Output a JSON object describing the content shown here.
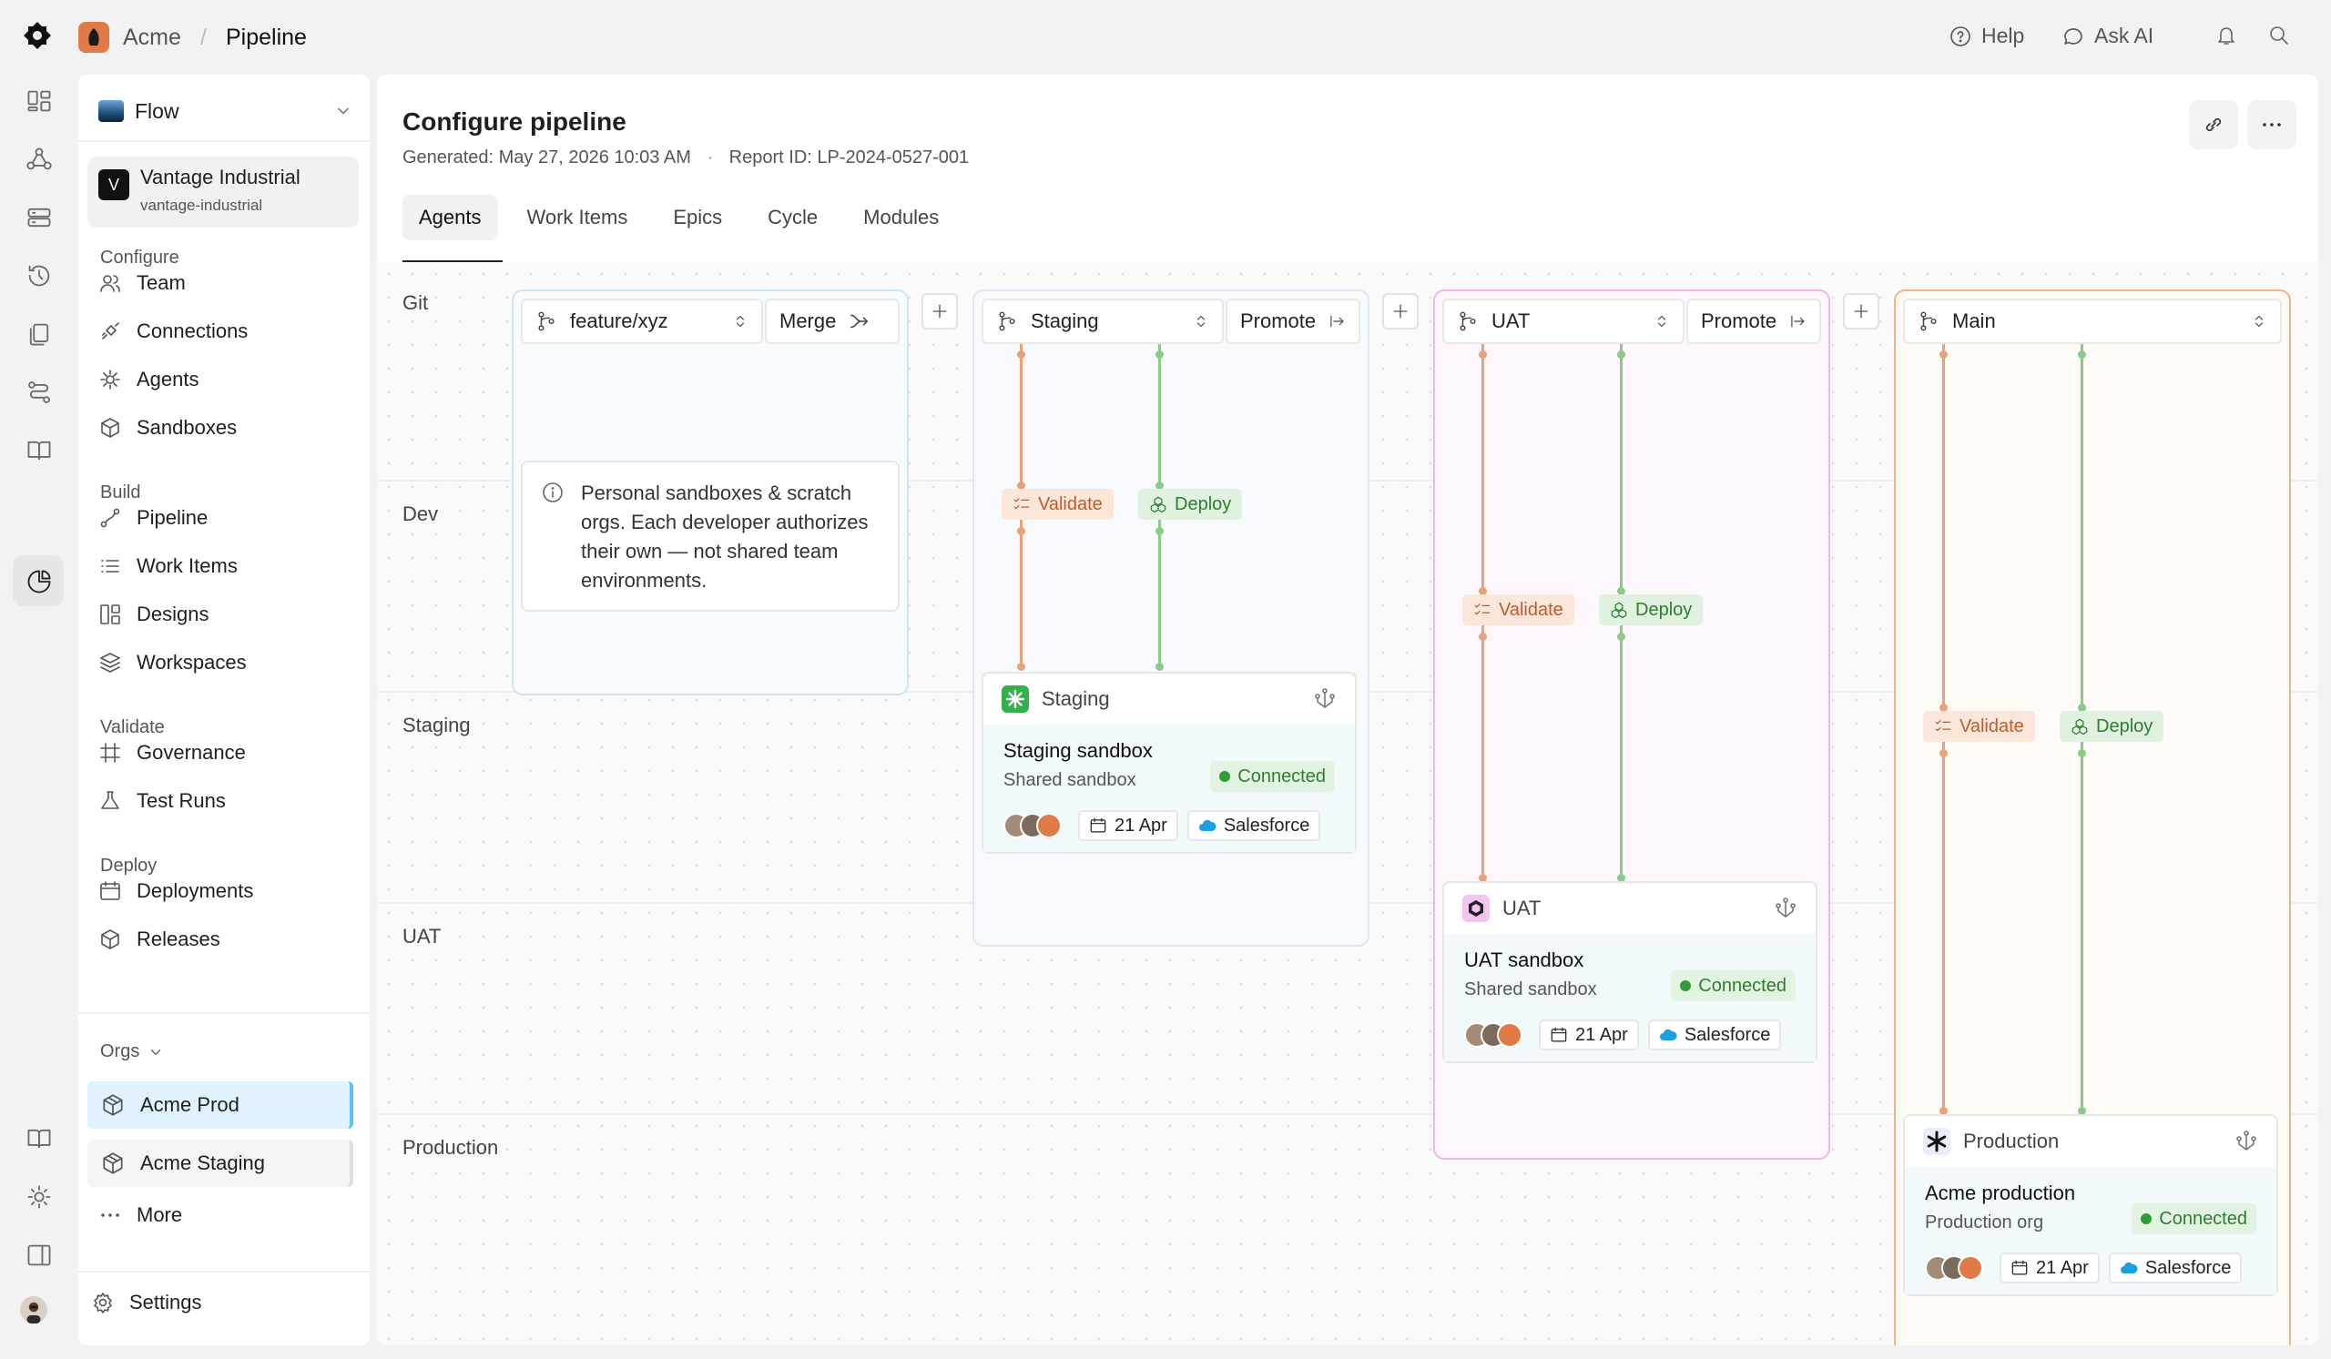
{
  "topbar": {
    "workspace": "Acme",
    "separator": "/",
    "page": "Pipeline",
    "help_label": "Help",
    "ask_ai_label": "Ask AI"
  },
  "rail": {
    "icons": [
      "dashboard-icon",
      "team-graph-icon",
      "server-icon",
      "history-icon",
      "copy-icon",
      "routes-icon",
      "book-icon",
      "analytics-icon"
    ],
    "bottom_icons": [
      "docs-icon",
      "sun-icon",
      "panel-icon",
      "user-avatar"
    ]
  },
  "sidebar": {
    "flow_label": "Flow",
    "org": {
      "initial": "V",
      "name": "Vantage Industrial",
      "slug": "vantage-industrial"
    },
    "sections": {
      "configure": "Configure",
      "build": "Build",
      "validate": "Validate",
      "deploy": "Deploy"
    },
    "configure_items": [
      "Team",
      "Connections",
      "Agents",
      "Sandboxes"
    ],
    "build_items": [
      "Pipeline",
      "Work Items",
      "Designs",
      "Workspaces"
    ],
    "validate_items": [
      "Governance",
      "Test Runs"
    ],
    "deploy_items": [
      "Deployments",
      "Releases"
    ],
    "orgs_label": "Orgs",
    "orgs": [
      "Acme Prod",
      "Acme Staging"
    ],
    "more_label": "More",
    "settings_label": "Settings"
  },
  "main": {
    "title": "Configure pipeline",
    "generated": "Generated: May 27, 2026 10:03 AM",
    "dot": "·",
    "report_id": "Report ID: LP-2024-0527-001",
    "tabs": [
      "Agents",
      "Work Items",
      "Epics",
      "Cycle",
      "Modules"
    ]
  },
  "rows": [
    "Git",
    "Dev",
    "Staging",
    "UAT",
    "Production"
  ],
  "lanes": {
    "feature": {
      "branch": "feature/xyz",
      "action": "Merge",
      "info": "Personal sandboxes & scratch orgs. Each developer authorizes their own — not shared team environments."
    },
    "staging": {
      "branch": "Staging",
      "action": "Promote"
    },
    "uat": {
      "branch": "UAT",
      "action": "Promote"
    },
    "main": {
      "branch": "Main"
    }
  },
  "chips": {
    "validate": "Validate",
    "deploy": "Deploy"
  },
  "envs": {
    "staging": {
      "head": "Staging",
      "name": "Staging sandbox",
      "sub": "Shared sandbox",
      "status": "Connected",
      "date": "21 Apr",
      "platform": "Salesforce"
    },
    "uat": {
      "head": "UAT",
      "name": "UAT sandbox",
      "sub": "Shared sandbox",
      "status": "Connected",
      "date": "21 Apr",
      "platform": "Salesforce"
    },
    "prod": {
      "head": "Production",
      "name": "Acme production",
      "sub": "Production org",
      "status": "Connected",
      "date": "21 Apr",
      "platform": "Salesforce"
    }
  },
  "colors": {
    "validate_line": "#e8a27a",
    "deploy_line": "#8cc98a",
    "feature_lane": "#c9e6f5",
    "staging_lane": "#dde6f3",
    "uat_lane": "#f1b6ec",
    "main_lane": "#f2b48a",
    "org_selected": "#dff2fd"
  }
}
